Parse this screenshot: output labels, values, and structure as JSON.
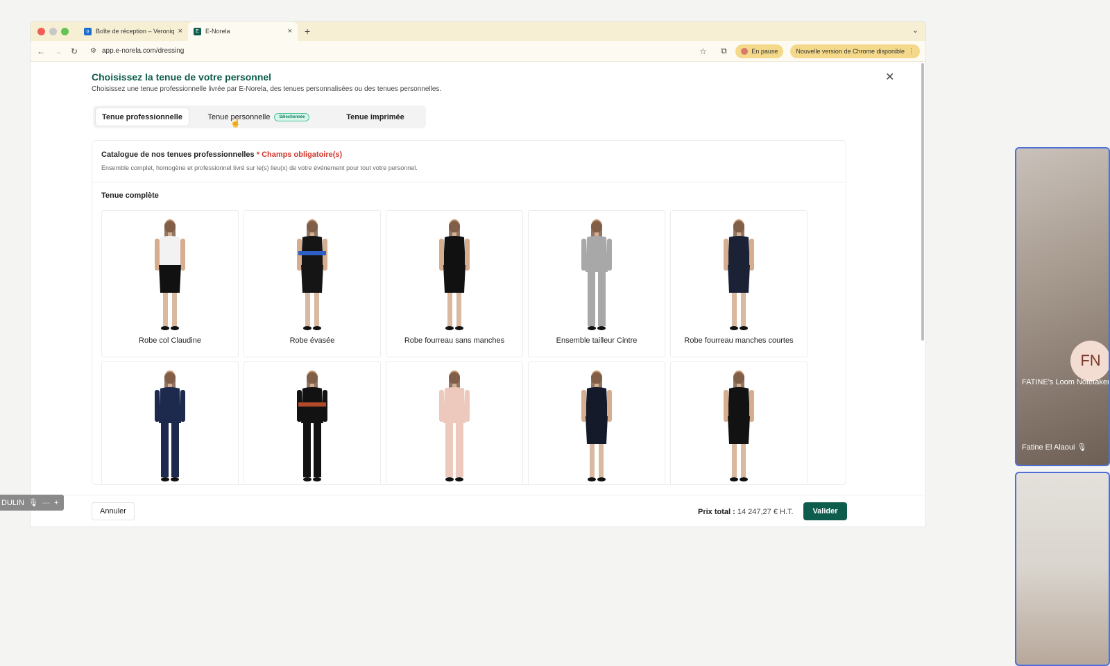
{
  "browser": {
    "tabs": [
      {
        "label": "Boîte de réception – Veroniq",
        "active": false
      },
      {
        "label": "E-Norela",
        "active": true
      }
    ],
    "url": "app.e-norela.com/dressing",
    "pause_label": "En pause",
    "update_label": "Nouvelle version de Chrome disponible"
  },
  "modal": {
    "title": "Choisissez la tenue de votre personnel",
    "subtitle": "Choisissez une tenue professionnelle livrée par E-Norela, des tenues personnalisées ou des tenues personnelles.",
    "tabs": [
      {
        "label": "Tenue professionnelle"
      },
      {
        "label": "Tenue personnelle",
        "badge": "Sélectionnée"
      },
      {
        "label": "Tenue imprimée"
      }
    ],
    "catalog": {
      "title": "Catalogue de nos tenues professionnelles",
      "required": "* Champs obligatoire(s)",
      "description": "Ensemble complet, homogène et professionnel livré sur le(s) lieu(x) de votre événement pour tout votre personnel."
    },
    "section_title": "Tenue complète",
    "items": [
      {
        "label": "Robe col Claudine",
        "top": "#f2f2f2",
        "bottom": "#111111",
        "style": "dress"
      },
      {
        "label": "Robe évasée",
        "top": "#151515",
        "bottom": "#151515",
        "style": "dress",
        "accent": "#2d5fc4"
      },
      {
        "label": "Robe fourreau sans manches",
        "top": "#111111",
        "bottom": "#111111",
        "style": "dress"
      },
      {
        "label": "Ensemble tailleur Cintre",
        "top": "#a8a8a8",
        "bottom": "#a8a8a8",
        "style": "suit"
      },
      {
        "label": "Robe fourreau manches courtes",
        "top": "#1b2236",
        "bottom": "#1b2236",
        "style": "dress"
      },
      {
        "label": "",
        "top": "#1e2a4d",
        "bottom": "#1e2a4d",
        "style": "suit"
      },
      {
        "label": "",
        "top": "#121212",
        "bottom": "#121212",
        "style": "suit",
        "accent": "#b34a2a"
      },
      {
        "label": "",
        "top": "#ecc9bc",
        "bottom": "#ecc9bc",
        "style": "suit"
      },
      {
        "label": "",
        "top": "#141a2a",
        "bottom": "#141a2a",
        "style": "dress"
      },
      {
        "label": "",
        "top": "#121212",
        "bottom": "#121212",
        "style": "dress"
      }
    ],
    "footer": {
      "cancel_label": "Annuler",
      "total_label": "Prix total :",
      "total_value": "14 247,27 € H.T.",
      "validate_label": "Valider"
    }
  },
  "overlay": {
    "mini_bar_label": "DULIN",
    "video_tiles": [
      {
        "initials": "FN",
        "title": "FATINE's Loom Notetaker",
        "name": "Fatine El Alaoui"
      }
    ]
  },
  "colors": {
    "brand": "#0d5c4c",
    "required": "#d0362b",
    "pill": "#f5d98a",
    "tile_border": "#4e6fd9"
  }
}
